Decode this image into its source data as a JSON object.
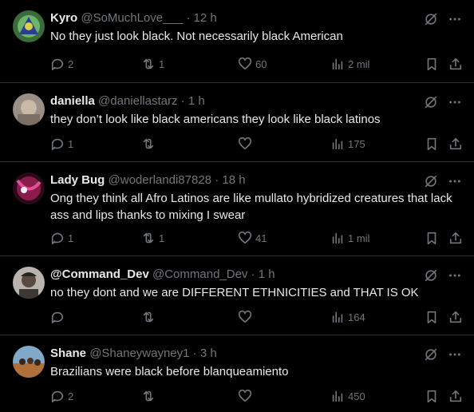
{
  "colors": {
    "background": "#000000",
    "text": "#e7e9ea",
    "muted": "#71767b",
    "divider": "#2f3336"
  },
  "icons": {
    "reply": "reply-icon",
    "retweet": "retweet-icon",
    "like": "heart-icon",
    "views": "views-icon",
    "bookmark": "bookmark-icon",
    "share": "share-icon",
    "grok": "grok-icon",
    "more": "more-icon"
  },
  "tweets": [
    {
      "name": "Kyro",
      "handle": "@SoMuchLove___",
      "sep": "·",
      "time": "12 h",
      "text": "No they just look black. Not necessarily black American",
      "replies": "2",
      "retweets": "1",
      "likes": "60",
      "views": "2 mil"
    },
    {
      "name": "daniella",
      "handle": "@daniellastarz",
      "sep": "·",
      "time": "1 h",
      "text": "they don’t look like black americans they look like black latinos",
      "replies": "1",
      "retweets": "",
      "likes": "",
      "views": "175"
    },
    {
      "name": "Lady Bug",
      "handle": "@woderlandi87828",
      "sep": "·",
      "time": "18 h",
      "text": "Ong they think all Afro Latinos are like mullato hybridized creatures that lack ass and lips thanks to mixing I swear",
      "replies": "1",
      "retweets": "1",
      "likes": "41",
      "views": "1 mil"
    },
    {
      "name": "@Command_Dev",
      "handle": "@Command_Dev",
      "sep": "·",
      "time": "1 h",
      "text": "no they dont and we are DIFFERENT ETHNICITIES and THAT IS OK",
      "replies": "",
      "retweets": "",
      "likes": "",
      "views": "164"
    },
    {
      "name": "Shane",
      "handle": "@Shaneywayney1",
      "sep": "·",
      "time": "3 h",
      "text": "Brazilians were black before blanqueamiento",
      "replies": "2",
      "retweets": "",
      "likes": "",
      "views": "450"
    }
  ]
}
